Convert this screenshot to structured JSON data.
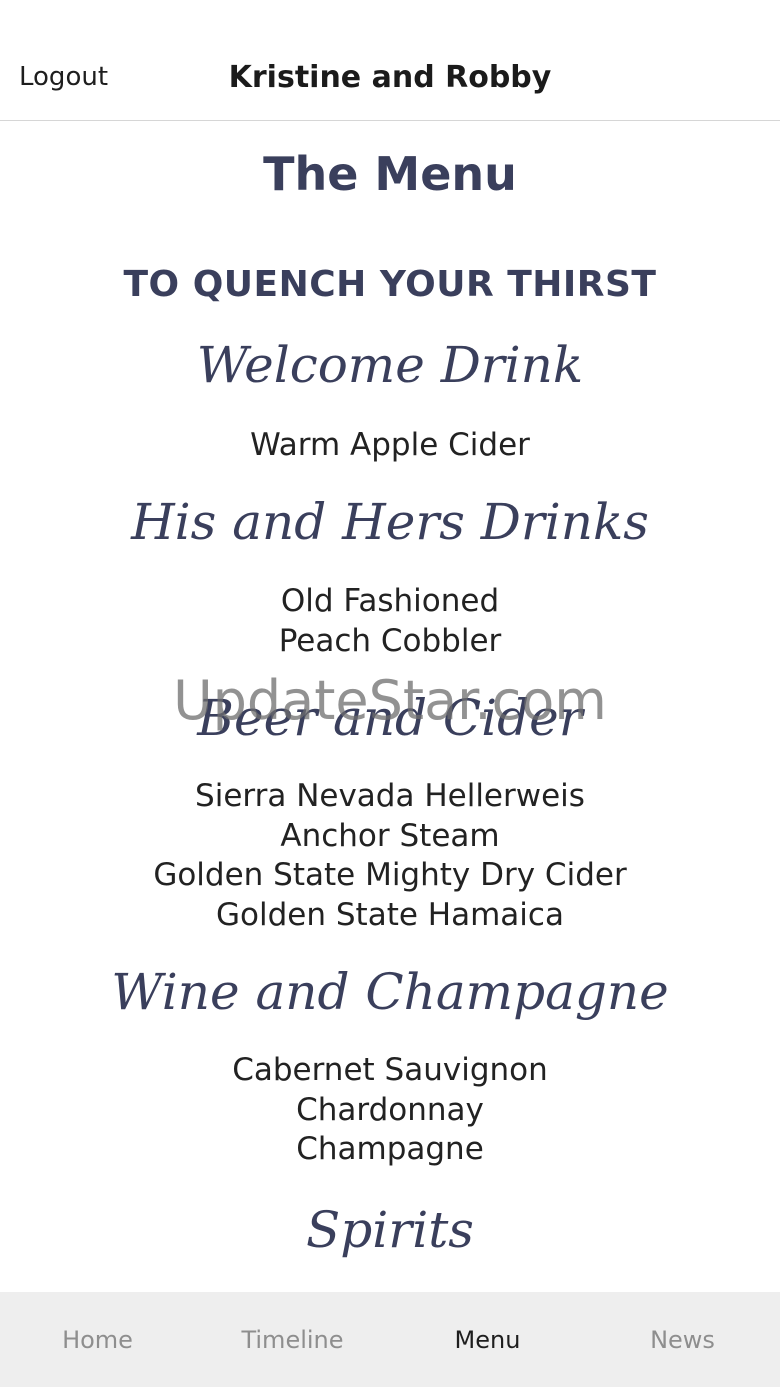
{
  "header": {
    "logout_label": "Logout",
    "title": "Kristine and Robby"
  },
  "main": {
    "page_title": "The Menu",
    "section_heading": "TO QUENCH YOUR THIRST",
    "groups": [
      {
        "title": "Welcome Drink",
        "items": [
          "Warm Apple Cider"
        ]
      },
      {
        "title": "His and Hers Drinks",
        "items": [
          "Old Fashioned",
          "Peach Cobbler"
        ]
      },
      {
        "title": "Beer and Cider",
        "items": [
          "Sierra Nevada Hellerweis",
          "Anchor Steam",
          "Golden State Mighty Dry Cider",
          "Golden State Hamaica"
        ]
      },
      {
        "title": "Wine and Champagne",
        "items": [
          "Cabernet Sauvignon",
          "Chardonnay",
          "Champagne"
        ]
      },
      {
        "title": "Spirits",
        "items": []
      }
    ]
  },
  "watermark": "UpdateStar.com",
  "tabbar": {
    "active": "Menu",
    "tabs": [
      {
        "label": "Home"
      },
      {
        "label": "Timeline"
      },
      {
        "label": "Menu"
      },
      {
        "label": "News"
      }
    ]
  },
  "colors": {
    "heading": "#3a3f5c",
    "text": "#222222",
    "tab_inactive": "#8e8e8e",
    "tab_active": "#1e1e1e",
    "tabbar_bg": "#eeeeee"
  }
}
